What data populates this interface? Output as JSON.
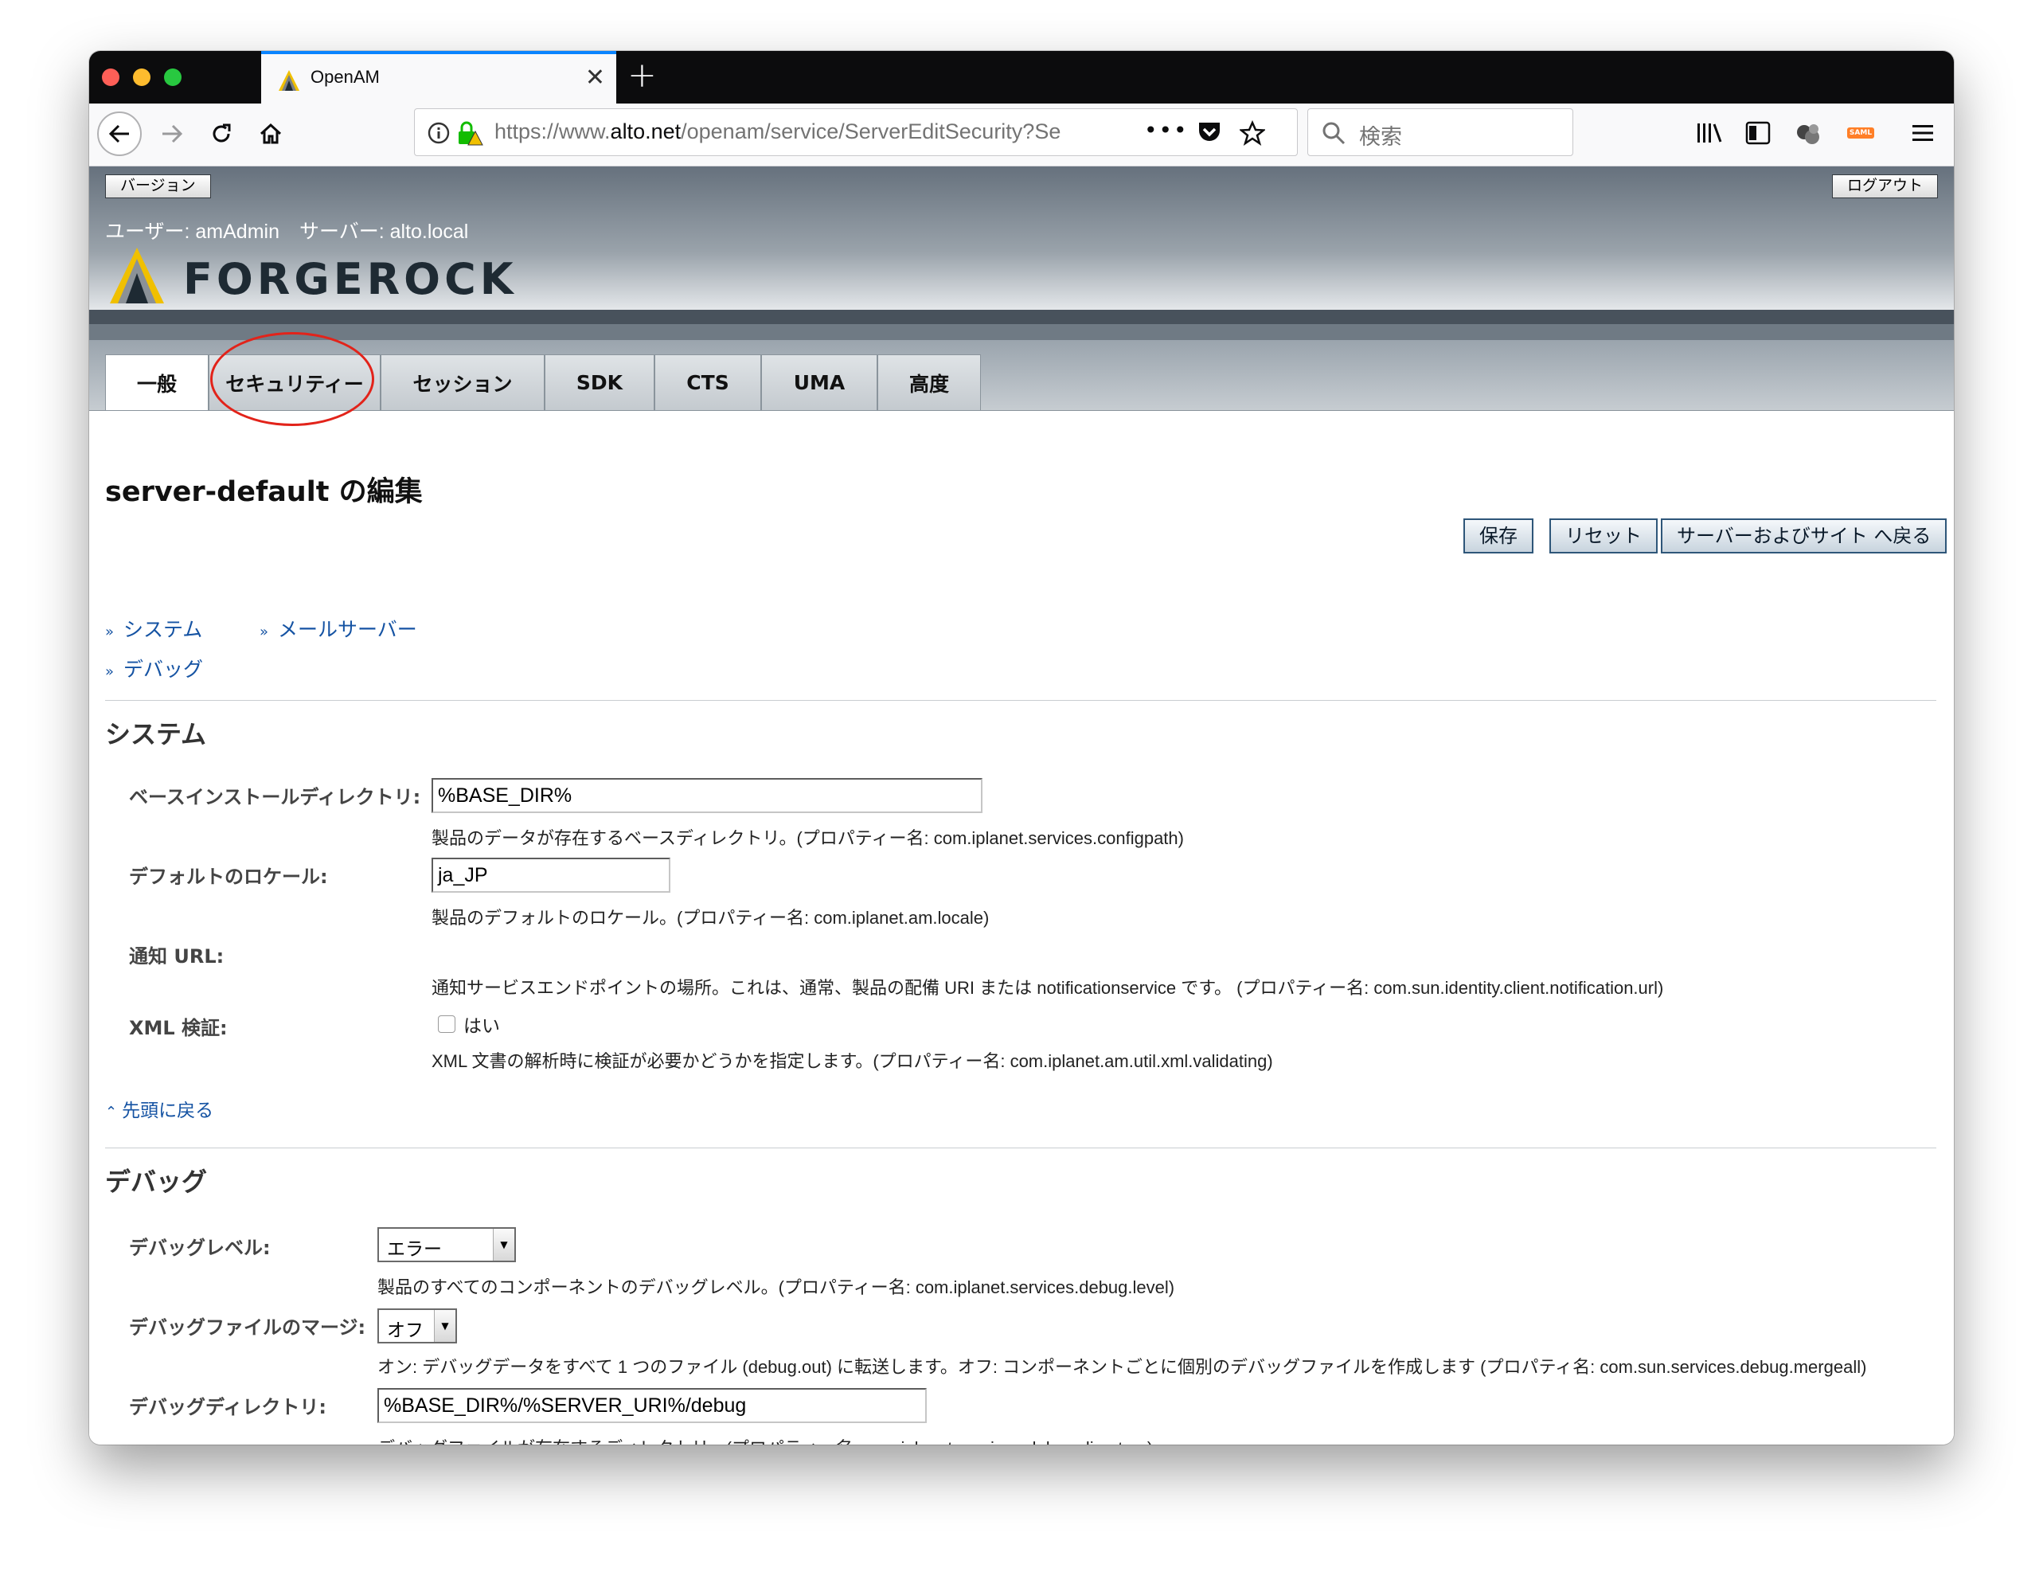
{
  "browser": {
    "tab_title": "OpenAM",
    "url_prefix": "https://www.",
    "url_host": "alto.net",
    "url_path": "/openam/service/ServerEditSecurity?Se",
    "search_placeholder": "検索"
  },
  "header": {
    "version_button": "バージョン",
    "logout_button": "ログアウト",
    "user_line": "ユーザー: amAdmin　サーバー: alto.local",
    "logo_text": "FORGEROCK"
  },
  "tabs": [
    {
      "label": "一般"
    },
    {
      "label": "セキュリティー"
    },
    {
      "label": "セッション"
    },
    {
      "label": "SDK"
    },
    {
      "label": "CTS"
    },
    {
      "label": "UMA"
    },
    {
      "label": "高度"
    }
  ],
  "page": {
    "title": "server-default の編集",
    "save_button": "保存",
    "reset_button": "リセット",
    "back_button": "サーバーおよびサイト へ戻る",
    "jump_links": {
      "system": "システム",
      "mail_server": "メールサーバー",
      "debug": "デバッグ"
    },
    "back_to_top": "先頭に戻る"
  },
  "system_section": {
    "heading": "システム",
    "base_dir_label": "ベースインストールディレクトリ:",
    "base_dir_value": "%BASE_DIR%",
    "base_dir_help": "製品のデータが存在するベースディレクトリ。(プロパティー名: com.iplanet.services.configpath)",
    "locale_label": "デフォルトのロケール:",
    "locale_value": "ja_JP",
    "locale_help": "製品のデフォルトのロケール。(プロパティー名: com.iplanet.am.locale)",
    "notify_label": "通知 URL:",
    "notify_help": "通知サービスエンドポイントの場所。これは、通常、製品の配備 URI または notificationservice です。 (プロパティー名: com.sun.identity.client.notification.url)",
    "xml_label": "XML 検証:",
    "xml_checkbox_label": "はい",
    "xml_help": "XML 文書の解析時に検証が必要かどうかを指定します。(プロパティー名: com.iplanet.am.util.xml.validating)"
  },
  "debug_section": {
    "heading": "デバッグ",
    "level_label": "デバッグレベル:",
    "level_value": "エラー",
    "level_help": "製品のすべてのコンポーネントのデバッグレベル。(プロパティー名: com.iplanet.services.debug.level)",
    "merge_label": "デバッグファイルのマージ:",
    "merge_value": "オフ",
    "merge_help": "オン: デバッグデータをすべて 1 つのファイル (debug.out) に転送します。オフ: コンポーネントごとに個別のデバッグファイルを作成します (プロパティ名: com.sun.services.debug.mergeall)",
    "dir_label": "デバッグディレクトリ:",
    "dir_value": "%BASE_DIR%/%SERVER_URI%/debug",
    "dir_help": "デバッグファイルが存在するディレクトリ。(プロパティー名: com.iplanet.services.debug.directory)"
  }
}
